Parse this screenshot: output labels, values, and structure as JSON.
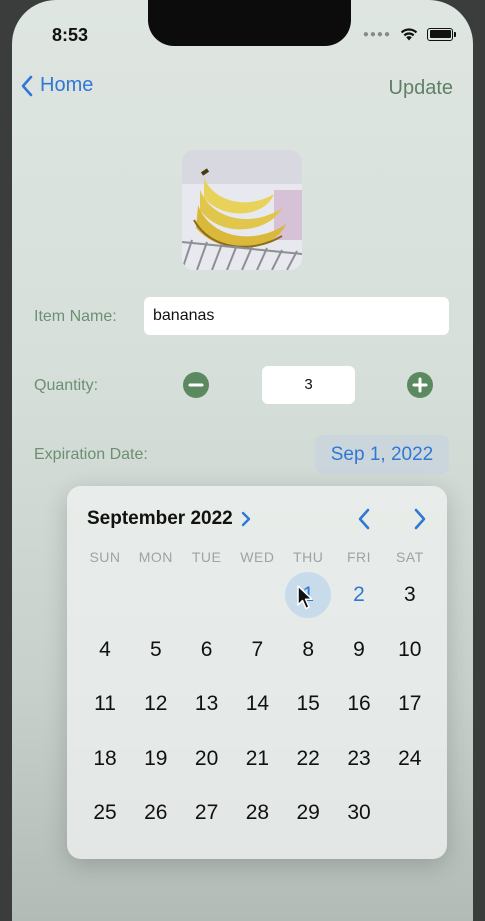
{
  "status_bar": {
    "time": "8:53"
  },
  "nav": {
    "back_label": "Home",
    "update_label": "Update"
  },
  "form": {
    "item_name_label": "Item Name:",
    "item_name_value": "bananas",
    "quantity_label": "Quantity:",
    "quantity_value": "3",
    "expiration_label": "Expiration Date:",
    "expiration_value": "Sep 1, 2022"
  },
  "calendar": {
    "month_label": "September 2022",
    "weekdays": [
      "SUN",
      "MON",
      "TUE",
      "WED",
      "THU",
      "FRI",
      "SAT"
    ],
    "weeks": [
      [
        "",
        "",
        "",
        "",
        "1",
        "2",
        "3"
      ],
      [
        "4",
        "5",
        "6",
        "7",
        "8",
        "9",
        "10"
      ],
      [
        "11",
        "12",
        "13",
        "14",
        "15",
        "16",
        "17"
      ],
      [
        "18",
        "19",
        "20",
        "21",
        "22",
        "23",
        "24"
      ],
      [
        "25",
        "26",
        "27",
        "28",
        "29",
        "30",
        ""
      ]
    ],
    "selected_day": "1"
  },
  "colors": {
    "accent_blue": "#2f78d4",
    "label_green": "#6d8f72",
    "stepper_green": "#5b8a60"
  }
}
